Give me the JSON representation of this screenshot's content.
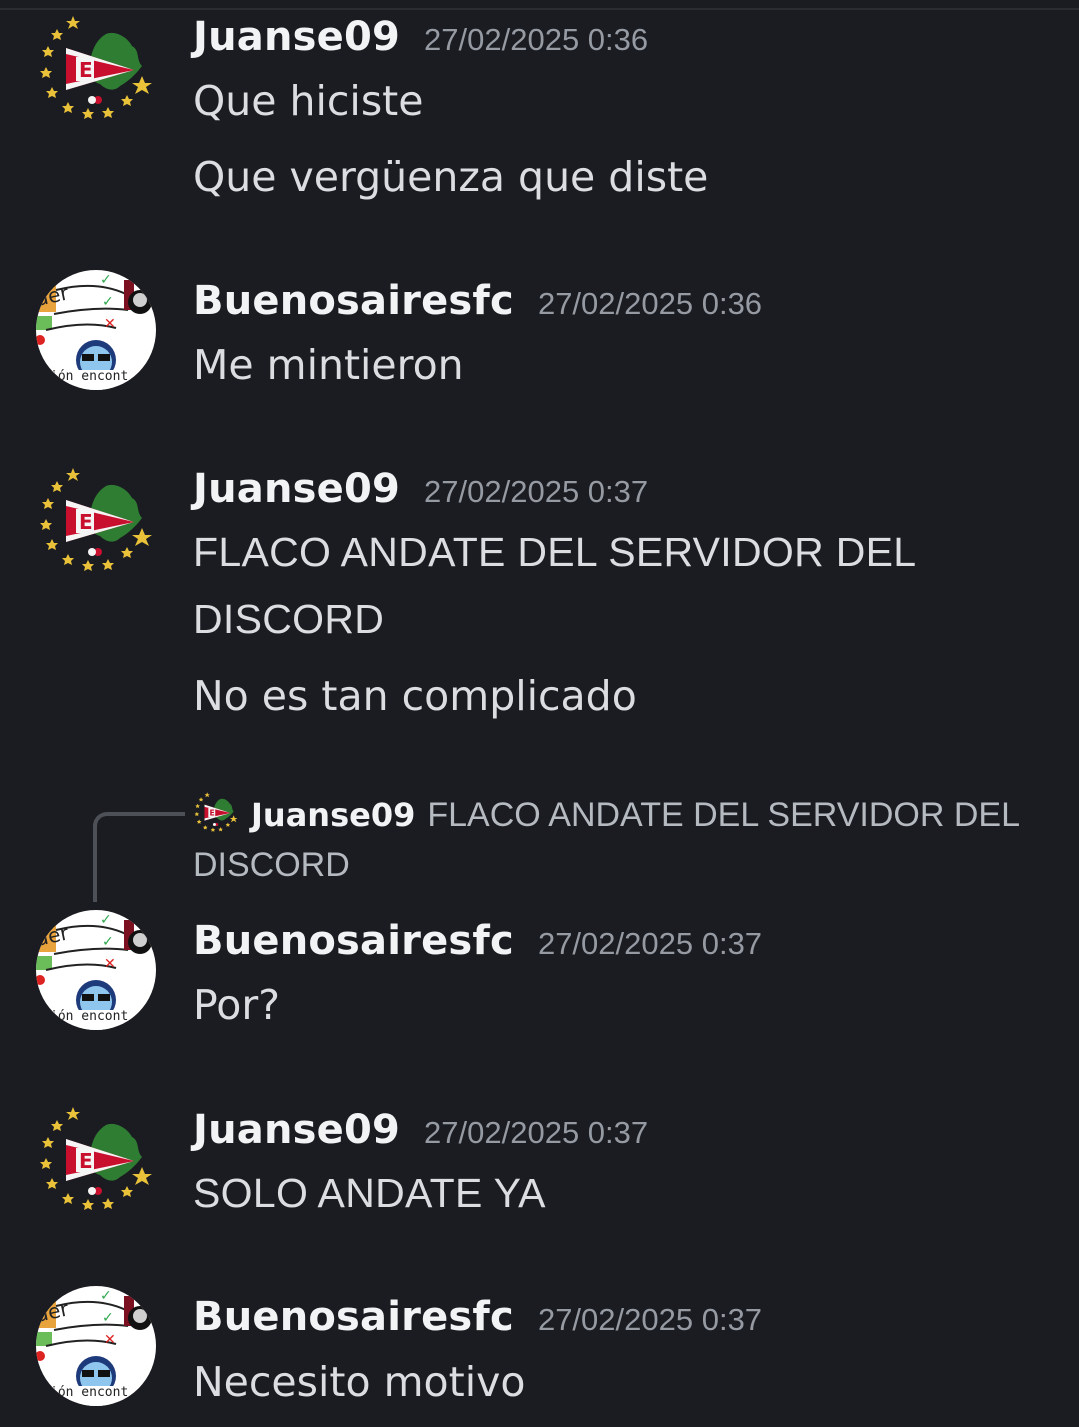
{
  "theme": {
    "background": "#1b1c21",
    "username_color": "#f2f3f5",
    "text_color": "#dbdde1",
    "timestamp_color": "#959aa3"
  },
  "messages": [
    {
      "username": "Juanse09",
      "timestamp": "27/02/2025 0:36",
      "avatar": "estudiantes-crest-icon",
      "lines": [
        "Que hiciste",
        "Que vergüenza que diste"
      ]
    },
    {
      "username": "Buenosairesfc",
      "timestamp": "27/02/2025 0:36",
      "avatar": "meme-collage-icon",
      "lines": [
        "Me mintieron"
      ]
    },
    {
      "username": "Juanse09",
      "timestamp": "27/02/2025 0:37",
      "avatar": "estudiantes-crest-icon",
      "lines": [
        "FLACO ANDATE DEL SERVIDOR DEL",
        "DISCORD",
        "No es tan complicado"
      ]
    },
    {
      "username": "Buenosairesfc",
      "timestamp": "27/02/2025 0:37",
      "avatar": "meme-collage-icon",
      "reply": {
        "username": "Juanse09",
        "text": "FLACO ANDATE DEL SERVIDOR DEL DISCORD"
      },
      "lines": [
        "Por?"
      ]
    },
    {
      "username": "Juanse09",
      "timestamp": "27/02/2025 0:37",
      "avatar": "estudiantes-crest-icon",
      "lines": [
        "SOLO ANDATE YA"
      ]
    },
    {
      "username": "Buenosairesfc",
      "timestamp": "27/02/2025 0:37",
      "avatar": "meme-collage-icon",
      "lines": [
        "Necesito motivo"
      ]
    }
  ]
}
